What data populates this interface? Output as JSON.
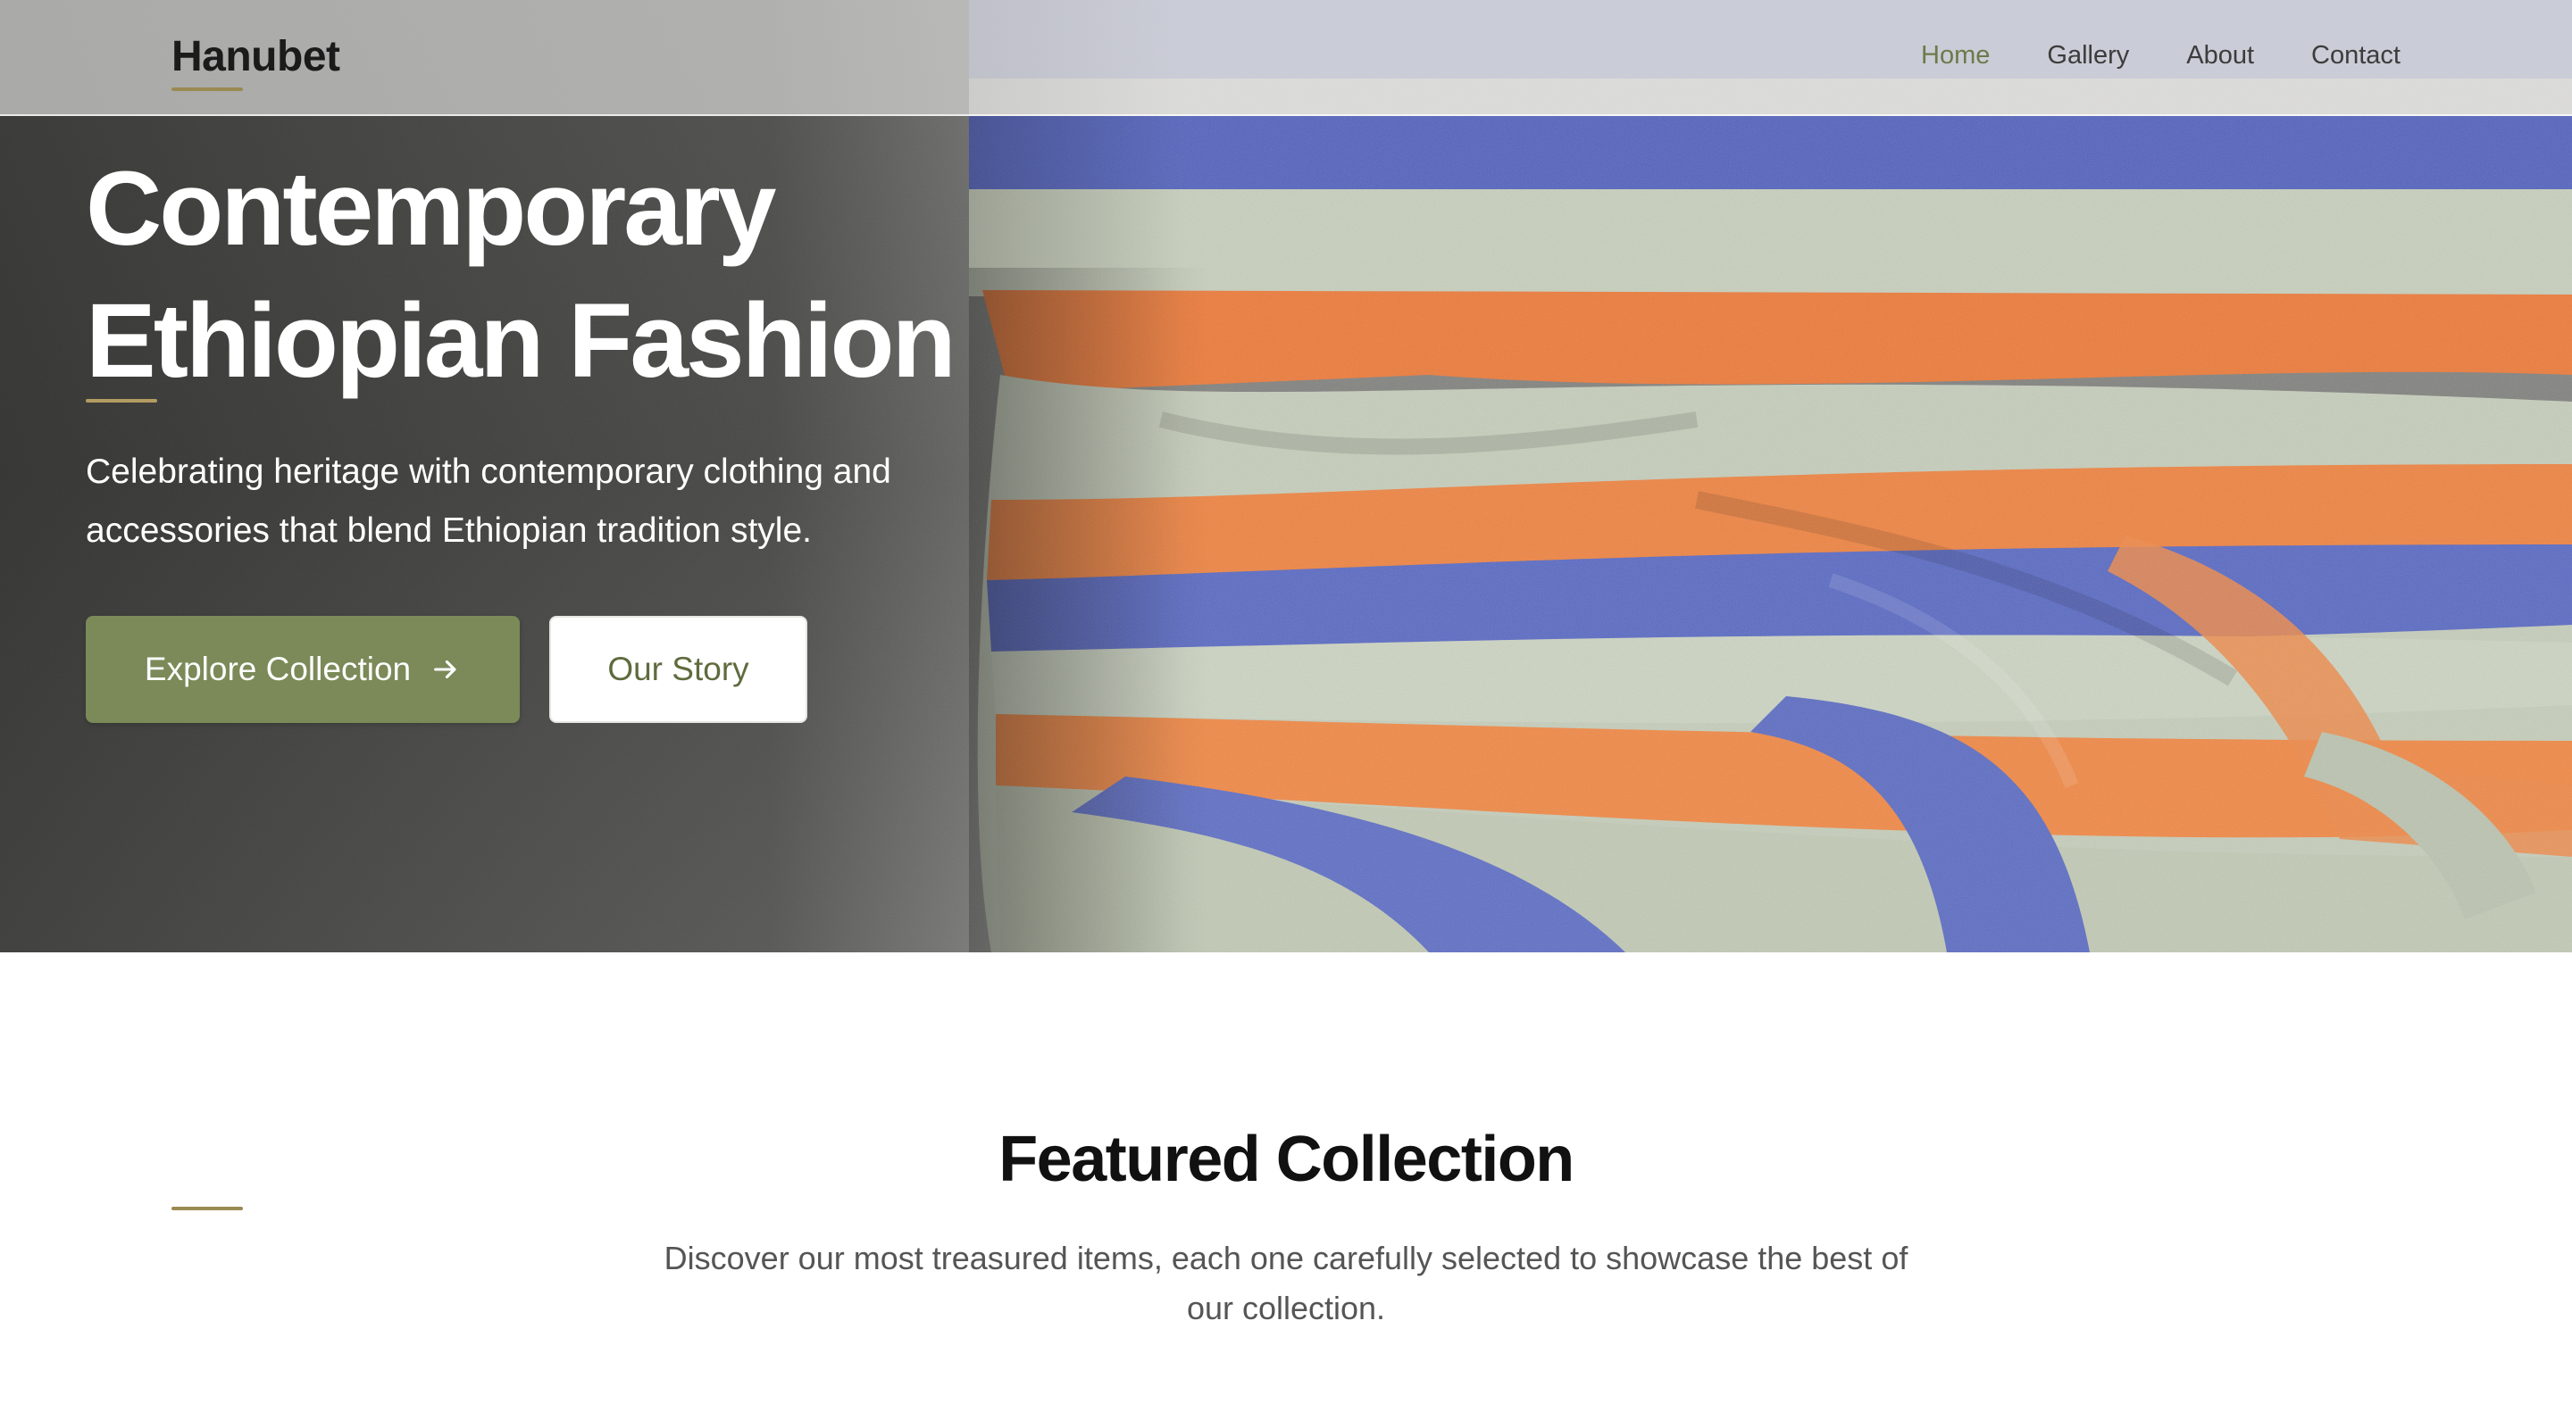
{
  "nav": {
    "brand": "Hanubet",
    "links": [
      {
        "label": "Home",
        "active": true
      },
      {
        "label": "Gallery",
        "active": false
      },
      {
        "label": "About",
        "active": false
      },
      {
        "label": "Contact",
        "active": false
      }
    ]
  },
  "hero": {
    "title_line1": "Contemporary",
    "title_line2": "Ethiopian Fashion",
    "subtitle": "Celebrating heritage with contemporary clothing and accessories that blend Ethiopian tradition style.",
    "primary_button": "Explore Collection",
    "secondary_button": "Our Story"
  },
  "featured": {
    "title": "Featured Collection",
    "description": "Discover our most treasured items, each one carefully selected to showcase the best of our collection."
  },
  "colors": {
    "accent_green": "#7b8a58",
    "active_nav": "#6c7a49",
    "accent_gold": "#9a8a52",
    "fabric_orange": "#f0823f",
    "fabric_blue": "#5b6bc2",
    "fabric_sage": "#c9d2bf"
  },
  "icons": {
    "primary_button_icon": "arrow-right-icon"
  }
}
